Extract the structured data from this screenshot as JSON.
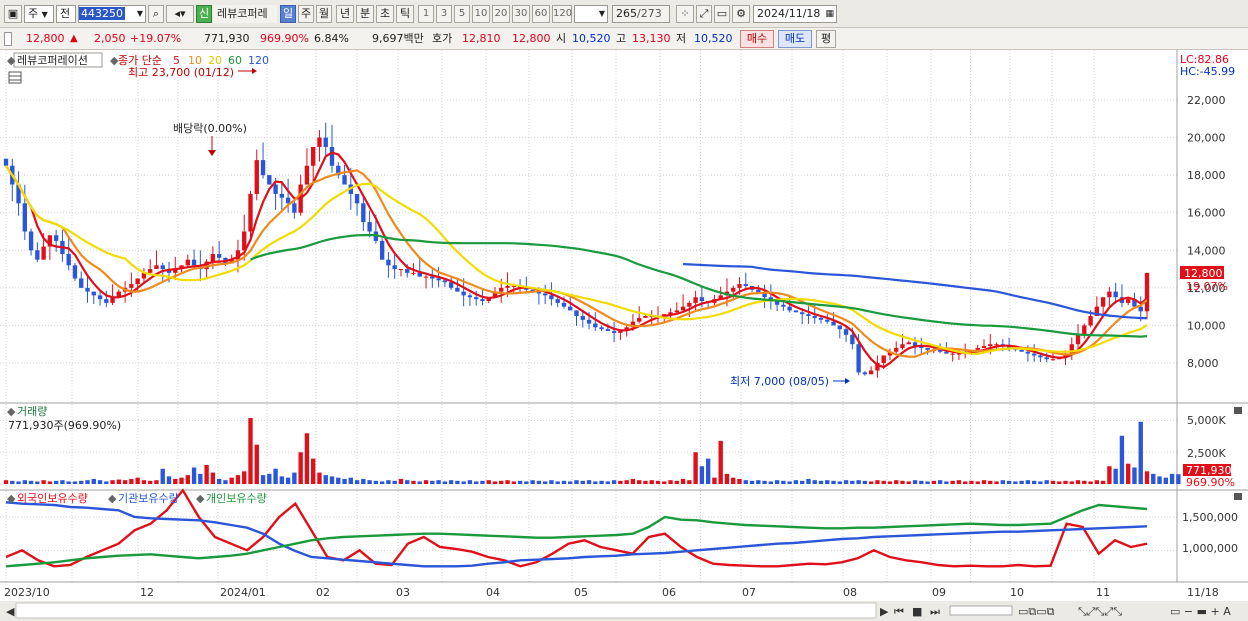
{
  "toolbar": {
    "market": "주",
    "type": "전",
    "code": "443250",
    "new_badge": "신",
    "stock_name": "레뷰코퍼레",
    "periods": [
      "일",
      "주",
      "월",
      "년",
      "분",
      "초",
      "틱"
    ],
    "numbers": [
      "1",
      "3",
      "5",
      "10",
      "20",
      "30",
      "60",
      "120"
    ],
    "count": "265",
    "total": "/273",
    "date": "2024/11/18"
  },
  "info": {
    "price": "12,800",
    "change": "2,050",
    "change_rate": "+19.07%",
    "volume": "771,930",
    "volume_rate": "969.90%",
    "turnover": "6.84%",
    "amount": "9,697백만",
    "quote_label": "호가",
    "ask": "12,810",
    "bid": "12,800",
    "open_label": "시",
    "open": "10,520",
    "high_label": "고",
    "high": "13,130",
    "low_label": "저",
    "low": "10,520",
    "buy_button": "매수",
    "sell_button": "매도",
    "avg_button": "평"
  },
  "price_panel": {
    "stock_label": "레뷰코퍼레이션",
    "ma_label": "종가 단순",
    "ma_periods": [
      "5",
      "10",
      "20",
      "60",
      "120"
    ],
    "ma_colors": [
      "#e0101a",
      "#f08a1c",
      "#f2dc00",
      "#1a9a3c",
      "#2a56d8"
    ],
    "max_label": "최고 23,700 (01/12)",
    "dividend_label": "배당락(0.00%)",
    "min_label": "최저 7,000 (08/05)",
    "lc": "LC:82.86",
    "hc": "HC:-45.99",
    "y_ticks": [
      "22,000",
      "20,000",
      "18,000",
      "16,000",
      "14,000",
      "12,000",
      "10,000",
      "8,000"
    ],
    "current_price": "12,800",
    "current_rate": "19.07%"
  },
  "volume_panel": {
    "title": "거래량",
    "value": "771,930주(969.90%)",
    "y_ticks": [
      "5,000K",
      "2,500K"
    ],
    "current_volume": "771,930",
    "current_rate": "969.90%"
  },
  "holding_panel": {
    "series_labels": [
      "외국인보유수량",
      "기관보유수량",
      "개인보유수량"
    ],
    "series_colors": [
      "#e0101a",
      "#2a56d8",
      "#1a9a3c"
    ],
    "y_ticks": [
      "1,500,000",
      "1,000,000"
    ]
  },
  "x_axis": {
    "labels": [
      "2023/10",
      "12",
      "2024/01",
      "02",
      "03",
      "04",
      "05",
      "06",
      "07",
      "08",
      "09",
      "10",
      "11",
      "11/18"
    ]
  },
  "chart_data": {
    "type": "candlestick",
    "price_range": [
      6500,
      23700
    ],
    "closes": [
      18500,
      17500,
      16500,
      15000,
      14000,
      13500,
      14200,
      14800,
      14500,
      13800,
      13200,
      12500,
      12000,
      11800,
      11600,
      11400,
      11200,
      11500,
      11800,
      12000,
      12200,
      12500,
      12800,
      13000,
      13200,
      13000,
      12800,
      13000,
      13200,
      13500,
      13200,
      13000,
      13400,
      13800,
      13600,
      13300,
      13500,
      14000,
      15000,
      17000,
      18800,
      18000,
      17500,
      17000,
      16800,
      16500,
      16000,
      17500,
      18500,
      19500,
      20000,
      19500,
      18500,
      18000,
      17500,
      17000,
      16500,
      15500,
      15000,
      14500,
      13500,
      13200,
      13000,
      13000,
      12800,
      12800,
      12600,
      12600,
      12500,
      12400,
      12300,
      12000,
      11800,
      11600,
      11500,
      11400,
      11300,
      11500,
      11800,
      12000,
      12100,
      12100,
      12000,
      11900,
      11800,
      11700,
      11600,
      11400,
      11200,
      11000,
      10800,
      10500,
      10300,
      10100,
      9900,
      9800,
      9700,
      9600,
      9700,
      9900,
      10200,
      10400,
      10500,
      10500,
      10500,
      10600,
      10700,
      10800,
      11000,
      11200,
      11500,
      11300,
      11200,
      11400,
      11600,
      11800,
      12000,
      12200,
      12100,
      11900,
      11700,
      11500,
      11300,
      11100,
      11000,
      10800,
      10700,
      10600,
      10500,
      10400,
      10300,
      10200,
      10000,
      9800,
      9500,
      9000,
      7500,
      7400,
      7600,
      8000,
      8400,
      8600,
      8800,
      9000,
      9100,
      8900,
      8800,
      8700,
      8700,
      8600,
      8500,
      8500,
      8500,
      8600,
      8700,
      8800,
      8900,
      9000,
      9000,
      8900,
      8800,
      8700,
      8600,
      8500,
      8400,
      8300,
      8200,
      8200,
      8300,
      8500,
      9000,
      9500,
      10000,
      10500,
      11000,
      11500,
      11800,
      11500,
      11200,
      11400,
      11000,
      10750,
      12800
    ],
    "volumes_thousands": [
      300,
      250,
      200,
      300,
      250,
      200,
      300,
      200,
      250,
      300,
      200,
      200,
      250,
      300,
      400,
      300,
      200,
      300,
      350,
      300,
      400,
      500,
      300,
      250,
      300,
      1200,
      600,
      400,
      500,
      700,
      1300,
      800,
      1500,
      900,
      400,
      300,
      500,
      700,
      1000,
      5200,
      3100,
      700,
      800,
      1200,
      600,
      500,
      900,
      2500,
      4000,
      2000,
      900,
      700,
      600,
      500,
      400,
      500,
      300,
      400,
      300,
      250,
      200,
      300,
      250,
      400,
      300,
      250,
      200,
      300,
      250,
      300,
      200,
      300,
      250,
      200,
      300,
      200,
      250,
      300,
      200,
      250,
      300,
      200,
      250,
      200,
      300,
      250,
      200,
      300,
      200,
      250,
      200,
      300,
      250,
      300,
      200,
      250,
      200,
      300,
      250,
      300,
      400,
      300,
      250,
      300,
      250,
      200,
      300,
      250,
      400,
      300,
      2500,
      1400,
      2000,
      500,
      3400,
      800,
      500,
      400,
      300,
      250,
      300,
      250,
      200,
      300,
      250,
      200,
      300,
      250,
      400,
      300,
      250,
      300,
      250,
      200,
      300,
      250,
      300,
      250,
      200,
      300,
      250,
      200,
      300,
      250,
      200,
      300,
      250,
      200,
      250,
      300,
      200,
      250,
      300,
      200,
      250,
      200,
      300,
      250,
      200,
      300,
      250,
      200,
      250,
      300,
      250,
      200,
      300,
      250,
      200,
      250,
      200,
      300,
      250,
      200,
      300,
      250,
      1400,
      1200,
      3800,
      1600,
      1300,
      4900,
      1000,
      800,
      600,
      500,
      800,
      772
    ],
    "holdings": {
      "foreign": [
        900,
        1000,
        850,
        760,
        780,
        900,
        1000,
        1100,
        1300,
        1400,
        1600,
        1900,
        1500,
        1200,
        1100,
        1000,
        1200,
        1500,
        1700,
        1300,
        900,
        850,
        1000,
        800,
        780,
        1100,
        1200,
        1050,
        1020,
        980,
        900,
        850,
        760,
        820,
        950,
        1100,
        1150,
        1050,
        1000,
        950,
        1200,
        1250,
        1050,
        900,
        800,
        780,
        770,
        760,
        760,
        780,
        800,
        790,
        820,
        880,
        1000,
        900,
        850,
        820,
        780,
        760,
        770,
        760,
        760,
        780,
        760,
        770,
        1400,
        1350,
        950,
        1150,
        1050,
        1100
      ],
      "institution": [
        1720,
        1700,
        1690,
        1680,
        1650,
        1640,
        1620,
        1600,
        1500,
        1480,
        1470,
        1460,
        1450,
        1420,
        1380,
        1340,
        1250,
        1100,
        990,
        900,
        880,
        860,
        840,
        820,
        800,
        780,
        760,
        760,
        760,
        770,
        800,
        820,
        850,
        860,
        870,
        880,
        900,
        910,
        920,
        940,
        950,
        960,
        980,
        1000,
        1020,
        1040,
        1060,
        1080,
        1100,
        1110,
        1130,
        1150,
        1170,
        1180,
        1200,
        1210,
        1220,
        1230,
        1240,
        1250,
        1260,
        1270,
        1280,
        1280,
        1290,
        1300,
        1310,
        1320,
        1330,
        1340,
        1350,
        1360
      ],
      "individual": [
        760,
        780,
        800,
        820,
        850,
        880,
        900,
        920,
        930,
        940,
        920,
        900,
        880,
        900,
        920,
        950,
        1000,
        1050,
        1100,
        1150,
        1180,
        1200,
        1210,
        1220,
        1230,
        1240,
        1250,
        1250,
        1240,
        1230,
        1220,
        1210,
        1200,
        1190,
        1190,
        1200,
        1210,
        1220,
        1230,
        1250,
        1350,
        1500,
        1460,
        1450,
        1420,
        1400,
        1380,
        1370,
        1360,
        1350,
        1340,
        1330,
        1330,
        1340,
        1340,
        1350,
        1360,
        1370,
        1380,
        1390,
        1400,
        1390,
        1380,
        1380,
        1390,
        1400,
        1500,
        1600,
        1680,
        1660,
        1640,
        1620
      ]
    }
  }
}
